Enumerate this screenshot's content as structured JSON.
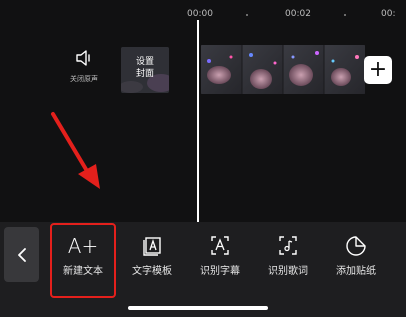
{
  "timeline": {
    "times": [
      "00:00",
      "00:02",
      "00:"
    ],
    "mute_label": "关闭原声",
    "cover_label_line1": "设置",
    "cover_label_line2": "封面",
    "add_clip_symbol": "+"
  },
  "toolbar": {
    "back_symbol": "<",
    "tools": [
      {
        "label": "新建文本",
        "icon": "A+"
      },
      {
        "label": "文字模板",
        "icon": "text-template-icon"
      },
      {
        "label": "识别字幕",
        "icon": "recognize-subtitle-icon"
      },
      {
        "label": "识别歌词",
        "icon": "recognize-lyrics-icon"
      },
      {
        "label": "添加贴纸",
        "icon": "sticker-icon"
      }
    ]
  },
  "colors": {
    "background": "#111112",
    "toolbar": "#1e1e20",
    "highlight": "#e4201c",
    "arrow": "#e4201c"
  }
}
